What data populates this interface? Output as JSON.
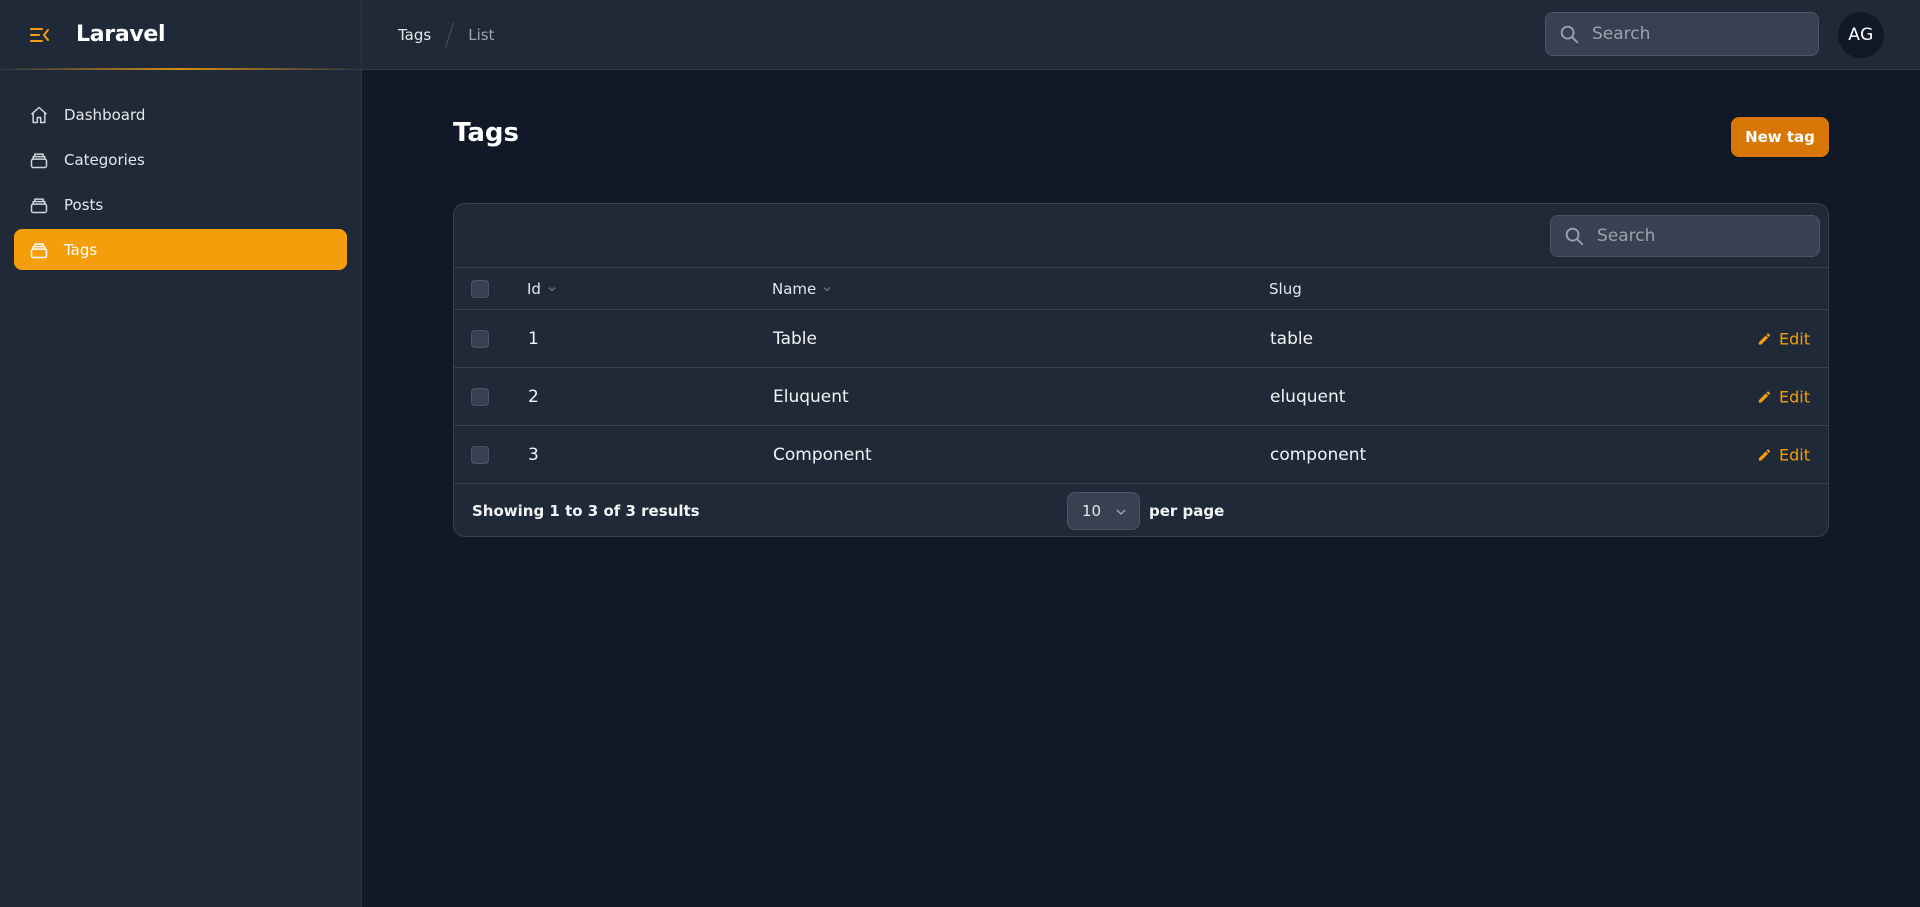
{
  "app": {
    "brand": "Laravel",
    "accent": "#f59e0b"
  },
  "sidebar": {
    "items": [
      {
        "label": "Dashboard",
        "icon": "home-icon",
        "active": false
      },
      {
        "label": "Categories",
        "icon": "collection-icon",
        "active": false
      },
      {
        "label": "Posts",
        "icon": "collection-icon",
        "active": false
      },
      {
        "label": "Tags",
        "icon": "collection-icon",
        "active": true
      }
    ]
  },
  "topbar": {
    "breadcrumb": [
      "Tags",
      "List"
    ],
    "search_placeholder": "Search",
    "avatar_initials": "AG"
  },
  "page": {
    "title": "Tags",
    "new_button": "New tag"
  },
  "table": {
    "search_placeholder": "Search",
    "columns": {
      "id": "Id",
      "name": "Name",
      "slug": "Slug"
    },
    "rows": [
      {
        "id": "1",
        "name": "Table",
        "slug": "table",
        "action": "Edit"
      },
      {
        "id": "2",
        "name": "Eluquent",
        "slug": "eluquent",
        "action": "Edit"
      },
      {
        "id": "3",
        "name": "Component",
        "slug": "component",
        "action": "Edit"
      }
    ],
    "footer": {
      "summary": "Showing 1 to 3 of 3 results",
      "per_page_value": "10",
      "per_page_label": "per page"
    }
  }
}
